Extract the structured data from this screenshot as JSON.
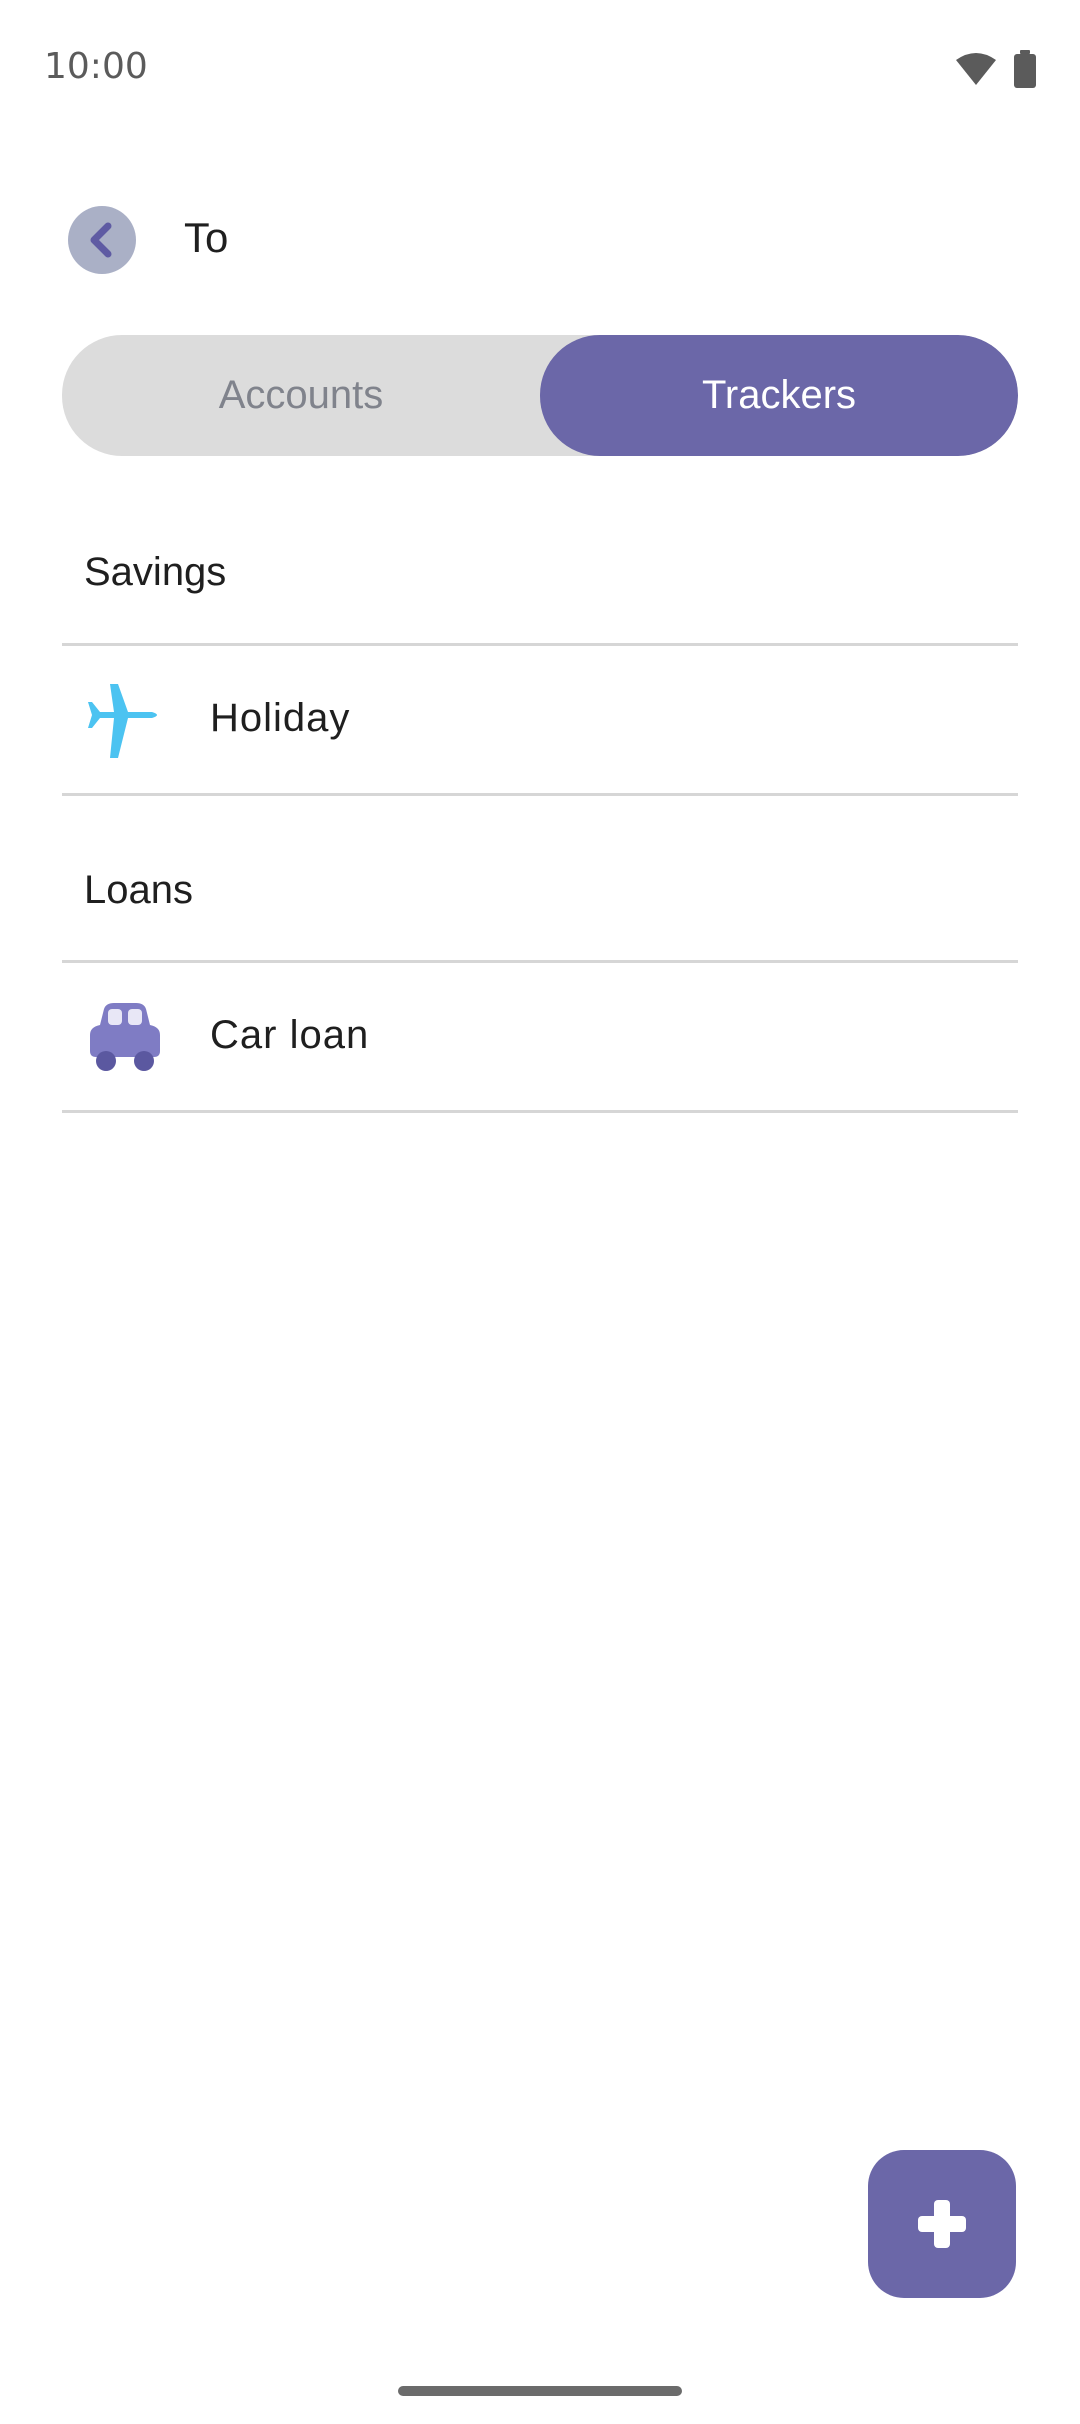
{
  "status_bar": {
    "time": "10:00"
  },
  "header": {
    "title": "To",
    "back_icon": "chevron-left-icon"
  },
  "tabs": [
    {
      "label": "Accounts",
      "selected": false
    },
    {
      "label": "Trackers",
      "selected": true
    }
  ],
  "sections": [
    {
      "title": "Savings",
      "items": [
        {
          "label": "Holiday",
          "icon": "airplane-icon"
        }
      ]
    },
    {
      "title": "Loans",
      "items": [
        {
          "label": "Car loan",
          "icon": "car-icon"
        }
      ]
    }
  ],
  "fab": {
    "icon": "plus-icon"
  },
  "colors": {
    "accent": "#6b67a8",
    "airplane": "#4cc3f1",
    "car": "#7f7cc4"
  }
}
